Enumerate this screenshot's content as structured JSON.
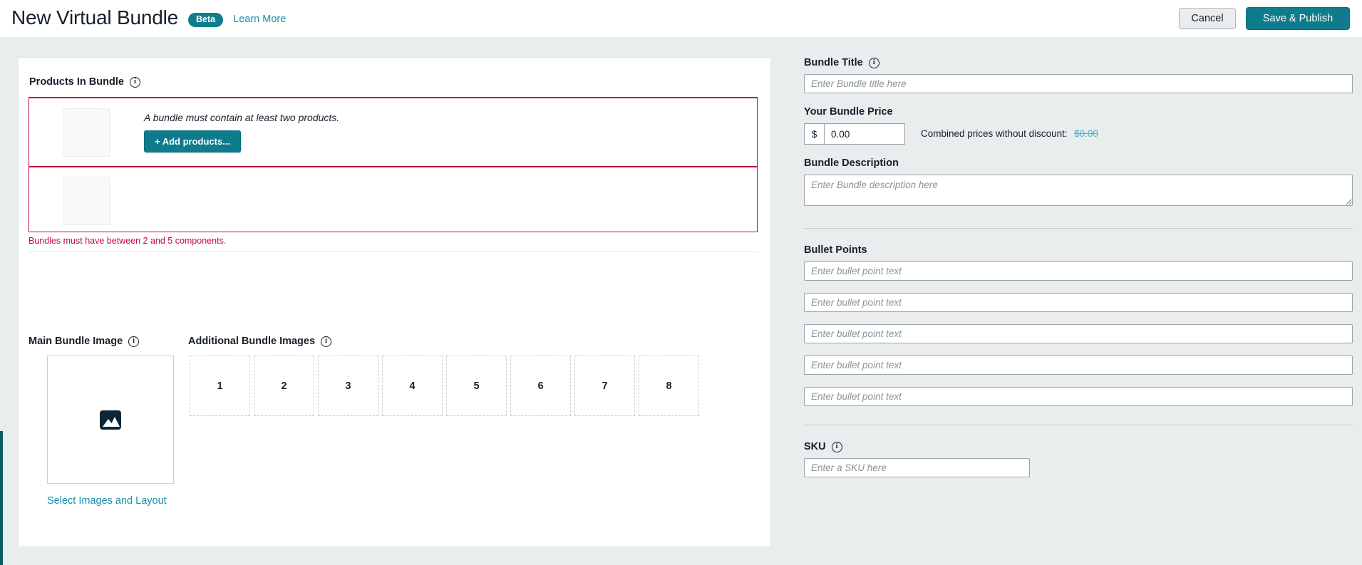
{
  "header": {
    "title": "New Virtual Bundle",
    "badge": "Beta",
    "learn_more": "Learn More",
    "cancel_label": "Cancel",
    "publish_label": "Save & Publish",
    "accent_color": "#0e7c8c",
    "link_color": "#1a8fa8"
  },
  "left": {
    "products_heading": "Products In Bundle",
    "rows": [
      {
        "note": "A bundle must contain at least two products.",
        "add_label": "+ Add products..."
      },
      {
        "note": "",
        "add_label": ""
      }
    ],
    "error_text": "Bundles must have between 2 and 5 components.",
    "error_color": "#c4093c",
    "main_image_heading": "Main Bundle Image",
    "additional_images_heading": "Additional Bundle Images",
    "image_placeholder_icon": "image-icon",
    "select_images_link": "Select Images and Layout",
    "thumb_slots": [
      "1",
      "2",
      "3",
      "4",
      "5",
      "6",
      "7",
      "8"
    ]
  },
  "right": {
    "bundle_title_label": "Bundle Title",
    "bundle_title_value": "",
    "bundle_title_placeholder": "Enter Bundle title here",
    "price_label": "Your Bundle Price",
    "price_prefix": "$",
    "price_value": "0.00",
    "combined_label": "Combined prices without discount:",
    "combined_value": "$0.00",
    "combined_value_color": "#4fb3c9",
    "description_label": "Bundle Description",
    "description_value": "",
    "description_placeholder": "Enter Bundle description here",
    "bullet_points_label": "Bullet Points",
    "bullet_placeholder": "Enter bullet point text",
    "bullets": [
      "",
      "",
      "",
      "",
      ""
    ],
    "sku_label": "SKU",
    "sku_value": "",
    "sku_placeholder": "Enter a SKU here"
  }
}
